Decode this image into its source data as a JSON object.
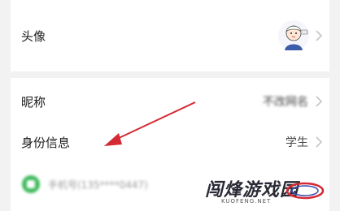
{
  "profile": {
    "avatar_label": "头像",
    "nickname_label": "昵称",
    "nickname_value": "不改网名",
    "identity_label": "身份信息",
    "identity_value": "学生",
    "phone_text": "手机号(135****0447)"
  },
  "watermark": {
    "title": "闯烽游戏园",
    "subtitle": "KUOFENG.NET"
  },
  "colors": {
    "arrow": "#d42a33",
    "wechat_green": "#3cb95a"
  }
}
